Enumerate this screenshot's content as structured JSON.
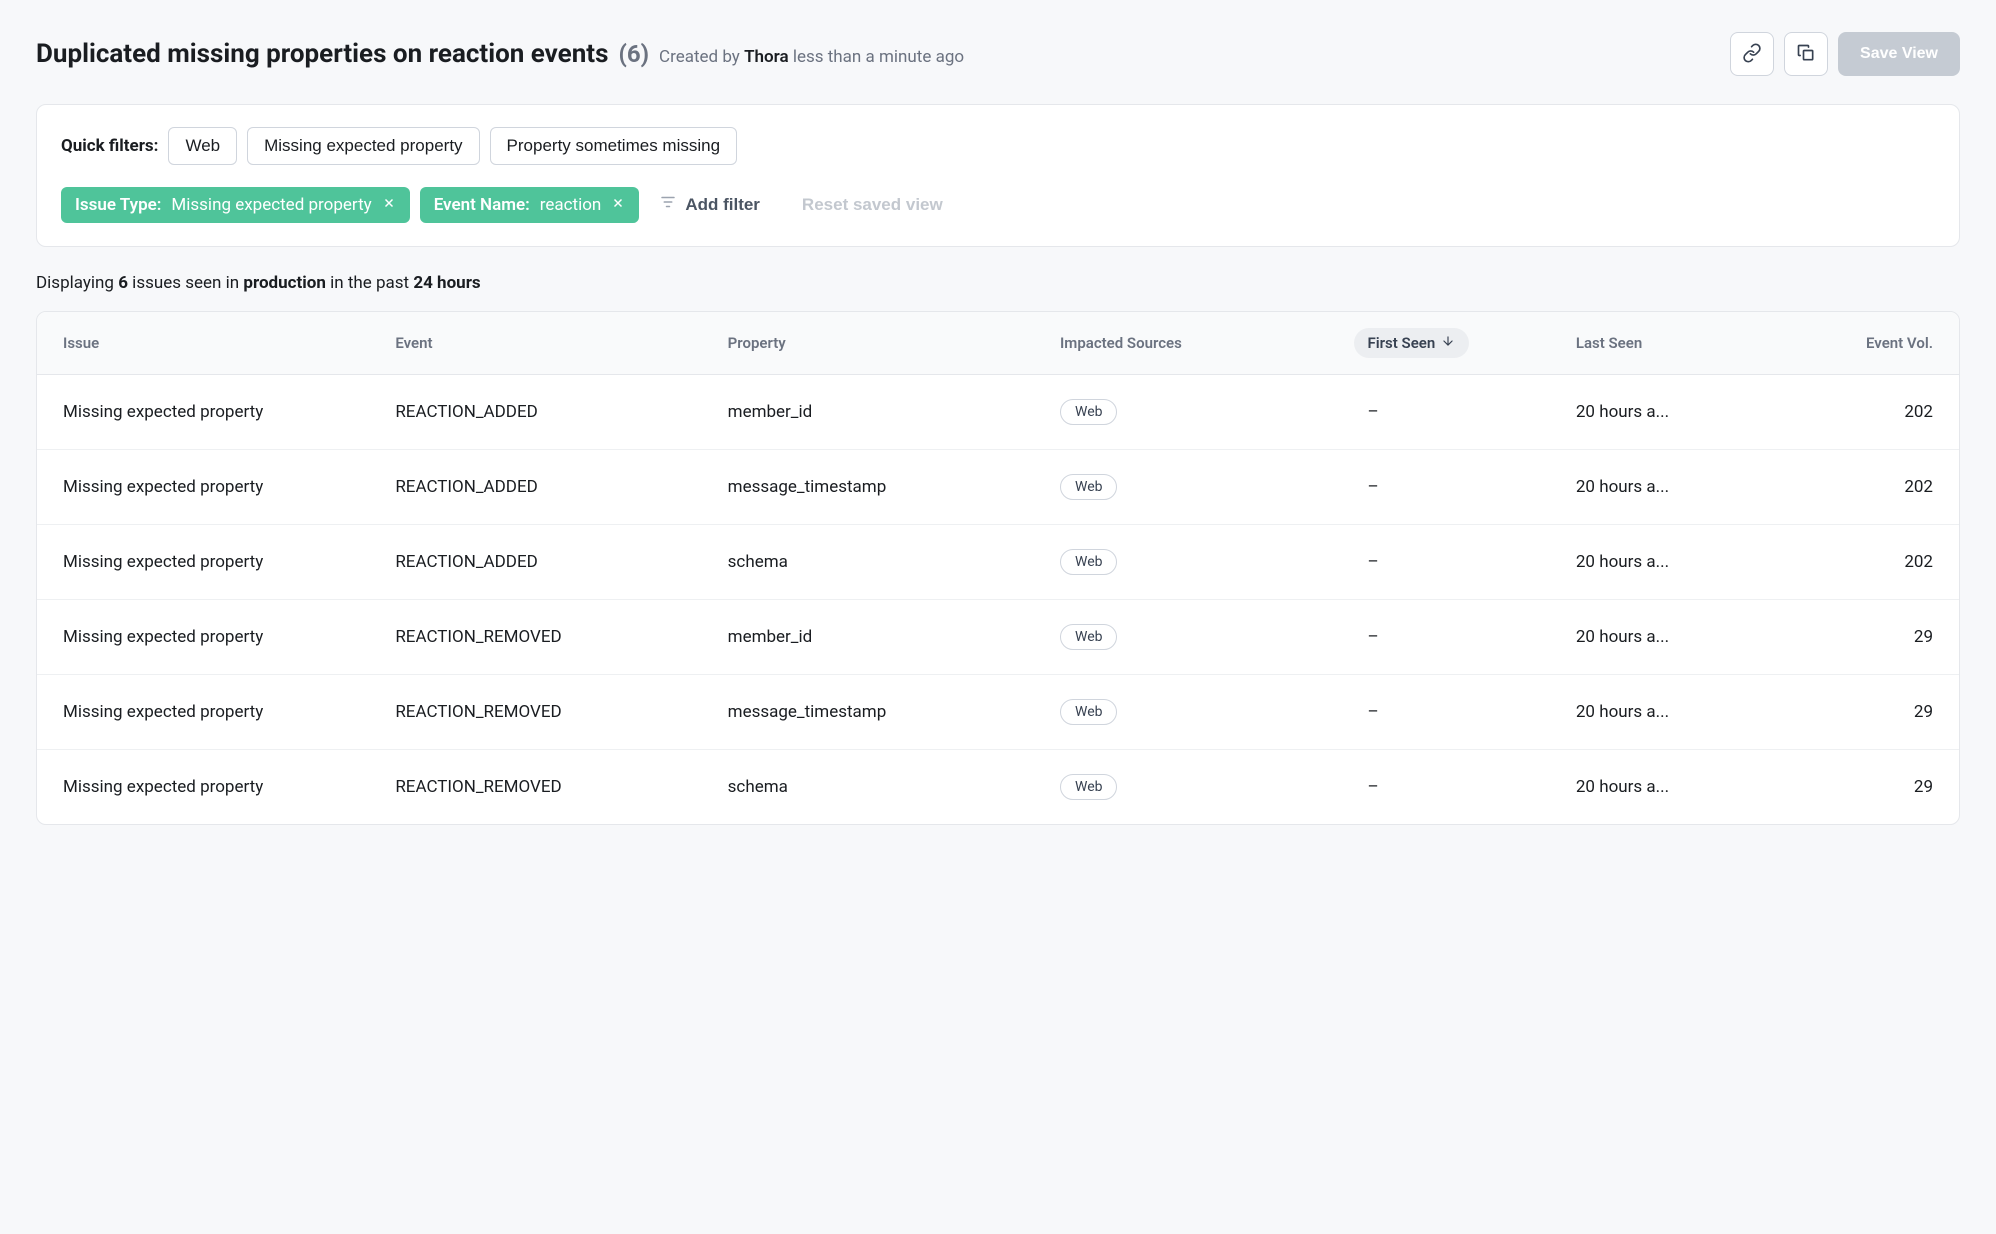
{
  "header": {
    "title": "Duplicated missing properties on reaction events",
    "count": "(6)",
    "created_prefix": "Created by ",
    "author": "Thora",
    "created_suffix": " less than a minute ago",
    "save_label": "Save View"
  },
  "filters": {
    "quick_label": "Quick filters:",
    "quick": [
      "Web",
      "Missing expected property",
      "Property sometimes missing"
    ],
    "active": [
      {
        "label": "Issue Type:",
        "value": "Missing expected property"
      },
      {
        "label": "Event Name:",
        "value": "reaction"
      }
    ],
    "add_filter": "Add filter",
    "reset": "Reset saved view"
  },
  "summary": {
    "prefix": "Displaying ",
    "count": "6",
    "mid1": " issues seen in ",
    "env": "production",
    "mid2": " in the past ",
    "window": "24 hours"
  },
  "table": {
    "columns": [
      "Issue",
      "Event",
      "Property",
      "Impacted Sources",
      "First Seen",
      "Last Seen",
      "Event Vol."
    ],
    "rows": [
      {
        "issue": "Missing expected property",
        "event": "REACTION_ADDED",
        "property": "member_id",
        "source": "Web",
        "first_seen": "–",
        "last_seen": "20 hours a...",
        "vol": "202"
      },
      {
        "issue": "Missing expected property",
        "event": "REACTION_ADDED",
        "property": "message_timestamp",
        "source": "Web",
        "first_seen": "–",
        "last_seen": "20 hours a...",
        "vol": "202"
      },
      {
        "issue": "Missing expected property",
        "event": "REACTION_ADDED",
        "property": "schema",
        "source": "Web",
        "first_seen": "–",
        "last_seen": "20 hours a...",
        "vol": "202"
      },
      {
        "issue": "Missing expected property",
        "event": "REACTION_REMOVED",
        "property": "member_id",
        "source": "Web",
        "first_seen": "–",
        "last_seen": "20 hours a...",
        "vol": "29"
      },
      {
        "issue": "Missing expected property",
        "event": "REACTION_REMOVED",
        "property": "message_timestamp",
        "source": "Web",
        "first_seen": "–",
        "last_seen": "20 hours a...",
        "vol": "29"
      },
      {
        "issue": "Missing expected property",
        "event": "REACTION_REMOVED",
        "property": "schema",
        "source": "Web",
        "first_seen": "–",
        "last_seen": "20 hours a...",
        "vol": "29"
      }
    ]
  }
}
